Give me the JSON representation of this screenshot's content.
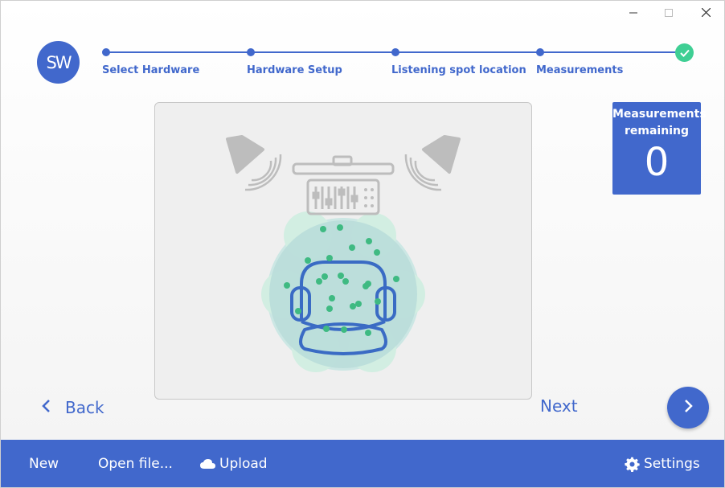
{
  "window": {
    "controls": [
      "minimize",
      "maximize",
      "close"
    ]
  },
  "logo": {
    "text": "SW"
  },
  "stepper": {
    "steps": [
      {
        "label": "Select Hardware"
      },
      {
        "label": "Hardware Setup"
      },
      {
        "label": "Listening spot location"
      },
      {
        "label": "Measurements"
      }
    ],
    "completed_icon": "check-icon"
  },
  "measurements": {
    "label": "Measurements remaining",
    "count": "0"
  },
  "nav": {
    "back_label": "Back",
    "next_label": "Next"
  },
  "footer": {
    "new_label": "New",
    "open_label": "Open file...",
    "upload_label": "Upload",
    "settings_label": "Settings"
  },
  "colors": {
    "accent": "#4168cc",
    "success": "#3fcf94",
    "gray": "#b8b8b8"
  }
}
